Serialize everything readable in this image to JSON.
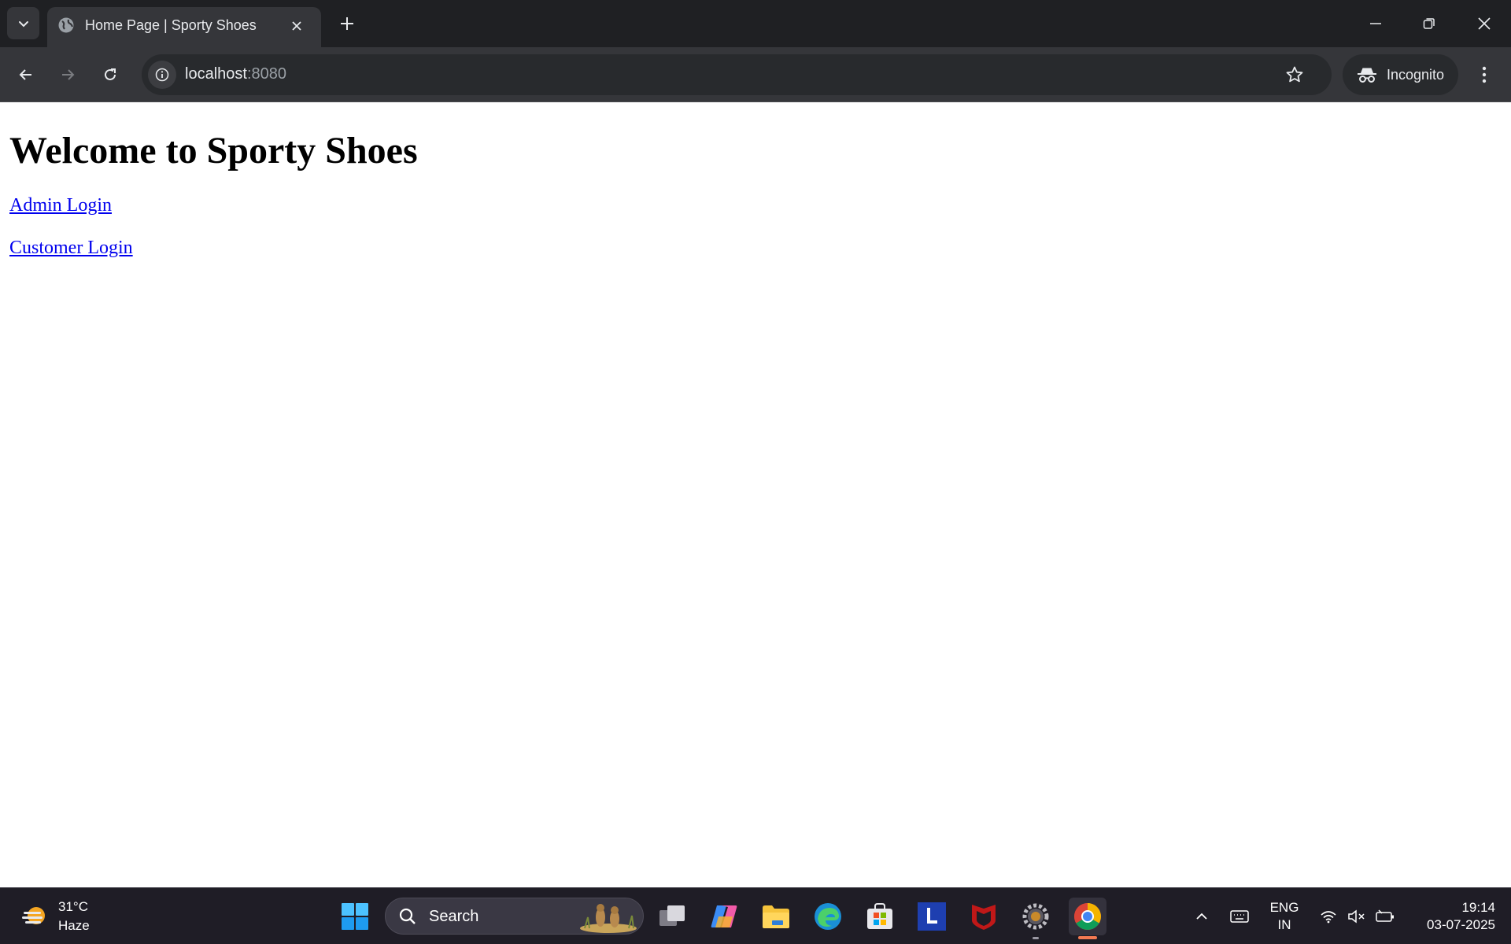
{
  "browser": {
    "tab_title": "Home Page | Sporty Shoes",
    "url_host": "localhost",
    "url_port": ":8080",
    "profile_label": "Incognito"
  },
  "page": {
    "heading": "Welcome to Sporty Shoes",
    "links": [
      "Admin Login",
      "Customer Login"
    ]
  },
  "taskbar": {
    "weather_temp": "31°C",
    "weather_desc": "Haze",
    "search_placeholder": "Search",
    "lang_line1": "ENG",
    "lang_line2": "IN",
    "time": "19:14",
    "date": "03-07-2025"
  },
  "colors": {
    "chrome_dark": "#1f2023",
    "toolbar": "#35363a",
    "link": "#0000ee",
    "taskbar": "#1f1d26",
    "active_indicator": "#f47a52"
  }
}
